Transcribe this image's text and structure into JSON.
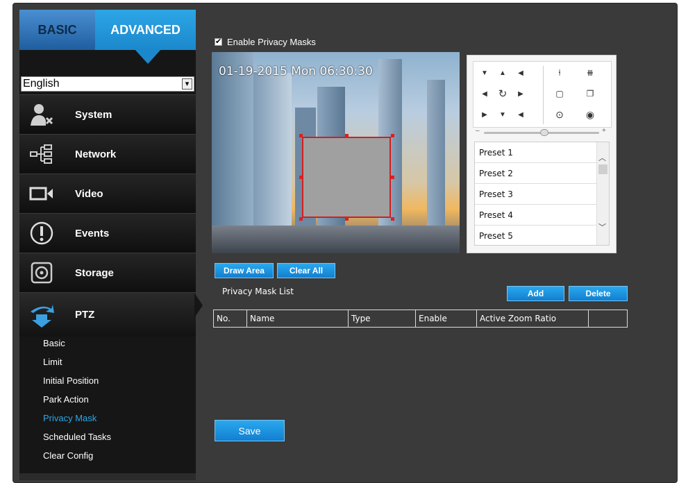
{
  "tabs": {
    "basic": "BASIC",
    "advanced": "ADVANCED"
  },
  "language": {
    "selected": "English"
  },
  "nav": [
    {
      "label": "System",
      "icon": "user-gear-icon"
    },
    {
      "label": "Network",
      "icon": "network-tree-icon"
    },
    {
      "label": "Video",
      "icon": "camera-icon"
    },
    {
      "label": "Events",
      "icon": "alert-circle-icon"
    },
    {
      "label": "Storage",
      "icon": "hard-disk-icon"
    },
    {
      "label": "PTZ",
      "icon": "ptz-arrows-icon"
    }
  ],
  "ptz_submenu": [
    {
      "label": "Basic",
      "active": false
    },
    {
      "label": "Limit",
      "active": false
    },
    {
      "label": "Initial Position",
      "active": false
    },
    {
      "label": "Park Action",
      "active": false
    },
    {
      "label": "Privacy Mask",
      "active": true
    },
    {
      "label": "Scheduled Tasks",
      "active": false
    },
    {
      "label": "Clear Config",
      "active": false
    }
  ],
  "privacy": {
    "enable_label": "Enable Privacy Masks",
    "enabled": true,
    "osd_text": "01-19-2015  Mon 06:30:30",
    "draw_area": "Draw Area",
    "clear_all": "Clear All",
    "list_title": "Privacy Mask List",
    "add": "Add",
    "delete": "Delete",
    "columns": [
      "No.",
      "Name",
      "Type",
      "Enable",
      "Active Zoom Ratio",
      ""
    ],
    "save": "Save"
  },
  "ptz_controls": {
    "presets": [
      "Preset 1",
      "Preset 2",
      "Preset 3",
      "Preset 4",
      "Preset 5"
    ]
  },
  "colors": {
    "accent": "#1b88cc",
    "active_sub": "#2da6e6",
    "mask_border": "#d31e1e",
    "panel_bg": "#3a3a3a"
  }
}
